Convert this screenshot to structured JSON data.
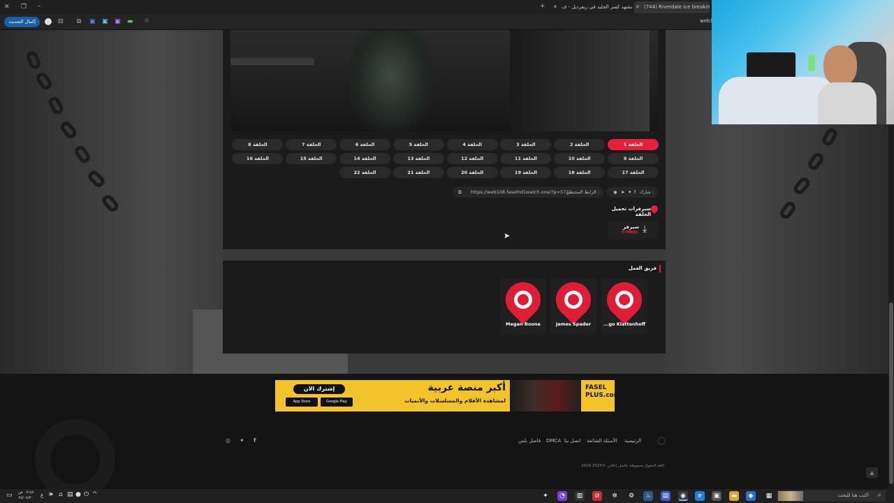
{
  "browser": {
    "tabs": [
      {
        "title": "(744) Riverdale ice breaking sc",
        "favicon": "youtube-icon"
      },
      {
        "title": "مشهد كسر الجليد في ريفرديل - ف",
        "favicon": "site-icon"
      }
    ],
    "new_tab_label": "+",
    "update_button": "إكمال التحديث",
    "address_partial": "web1"
  },
  "episodes": {
    "active_index": 0,
    "items": [
      "الحلقة 1",
      "الحلقة 2",
      "الحلقة 3",
      "الحلقة 4",
      "الحلقة 5",
      "الحلقة 6",
      "الحلقة 7",
      "الحلقة 8",
      "الحلقة 9",
      "الحلقة 10",
      "الحلقة 11",
      "الحلقة 12",
      "الحلقة 13",
      "الحلقة 14",
      "الحلقة 15",
      "الحلقة 16",
      "الحلقة 17",
      "الحلقة 18",
      "الحلقة 19",
      "الحلقة 20",
      "الحلقة 21",
      "الحلقة 22"
    ]
  },
  "share": {
    "label": "شارك :",
    "short_link_label": "الرابط المختصر :",
    "short_link": "https://web108.faselhd1watch.one/?p=5721"
  },
  "download": {
    "heading": "سيرفرات تحميل الحلقة",
    "server_label": "سيرفر",
    "server_name": "T7MEEL"
  },
  "crew": {
    "heading": "فريق العمل",
    "members": [
      "Megan Boone",
      "James Spader",
      "...go Klattenhoff"
    ]
  },
  "ad": {
    "cta": "إشترك الان",
    "headline": "أكبر منصة عربية",
    "subline": "لمشاهدة الأفلام والمسلسلات والأنميات",
    "store1": "App Store",
    "store2": "Google Play",
    "brand": "FASEL PLUS.com"
  },
  "footer": {
    "links": [
      "الرئيسية",
      "الأسئلة الشائعة",
      "اتصل بنا",
      "DMCA",
      "فاصل بلس"
    ],
    "copyright": "2016-2025© كافة الحقوق محفوظة. فاصل إعلاني."
  },
  "taskbar": {
    "search_placeholder": "اكتب هنا للبحث",
    "clock_time": "٠٧:٤٥ ص",
    "clock_date": "٢٥/٠٧/٢٠"
  },
  "colors": {
    "accent": "#e5203a",
    "ad_yellow": "#f3c42a"
  }
}
